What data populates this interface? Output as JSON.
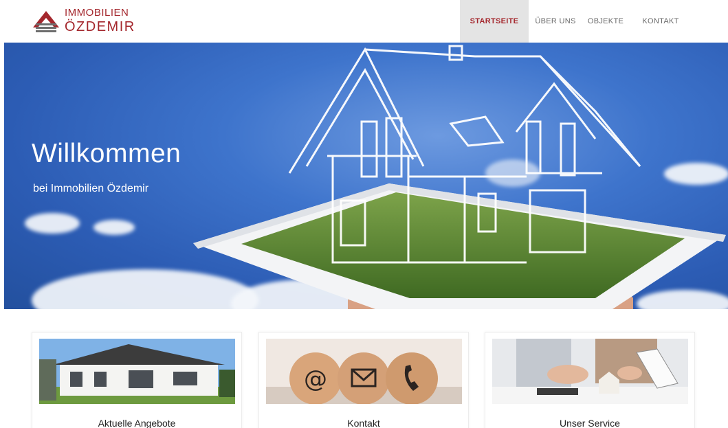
{
  "header": {
    "logo_line1": "IMMOBILIEN",
    "logo_line2": "ÖZDEMIR",
    "nav": [
      {
        "label": "STARTSEITE",
        "active": true
      },
      {
        "label": "ÜBER UNS",
        "active": false
      },
      {
        "label": "OBJEKTE",
        "active": false
      },
      {
        "label": "KONTAKT",
        "active": false
      }
    ]
  },
  "hero": {
    "title": "Willkommen",
    "subtitle": "bei Immobilien Özdemir"
  },
  "cards": [
    {
      "title": "Aktuelle Angebote",
      "icon": "house-photo"
    },
    {
      "title": "Kontakt",
      "icon": "contact-blocks-photo"
    },
    {
      "title": "Unser Service",
      "icon": "service-photo"
    }
  ],
  "colors": {
    "brand": "#a4272d",
    "hero_blue": "#3e74cc",
    "nav_active_bg": "#e4e4e4"
  }
}
